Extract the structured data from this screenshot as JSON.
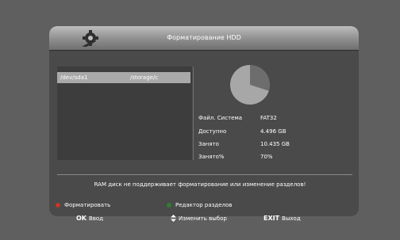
{
  "window": {
    "title": "Форматирование HDD"
  },
  "devices": [
    {
      "device": "/dev/sda1",
      "mount": "/storage/c"
    }
  ],
  "info": {
    "fs_label": "Файл. Система",
    "fs_value": "FAT32",
    "avail_label": "Доступно",
    "avail_value": "4.496 GB",
    "used_label": "Занято",
    "used_value": "10.435 GB",
    "usedpct_label": "Занято%",
    "usedpct_value": "70%"
  },
  "usage": {
    "used_fraction": 0.7,
    "used_color": "#a7a7a7",
    "free_color": "#6d6d6d"
  },
  "warning": "RAM диск не поддерживает форматирование или изменение разделов!",
  "actions": {
    "format_label": "Форматировать",
    "format_color": "#c0392b",
    "partition_label": "Редактор разделов",
    "partition_color": "#2e7d32"
  },
  "footer": {
    "ok_key": "OK",
    "ok_label": "Ввод",
    "nav_label": "Изменить выбор",
    "exit_key": "EXIT",
    "exit_label": "Выход"
  },
  "icons": {
    "gear": "gear-icon",
    "updown": "up-down-arrows-icon"
  }
}
